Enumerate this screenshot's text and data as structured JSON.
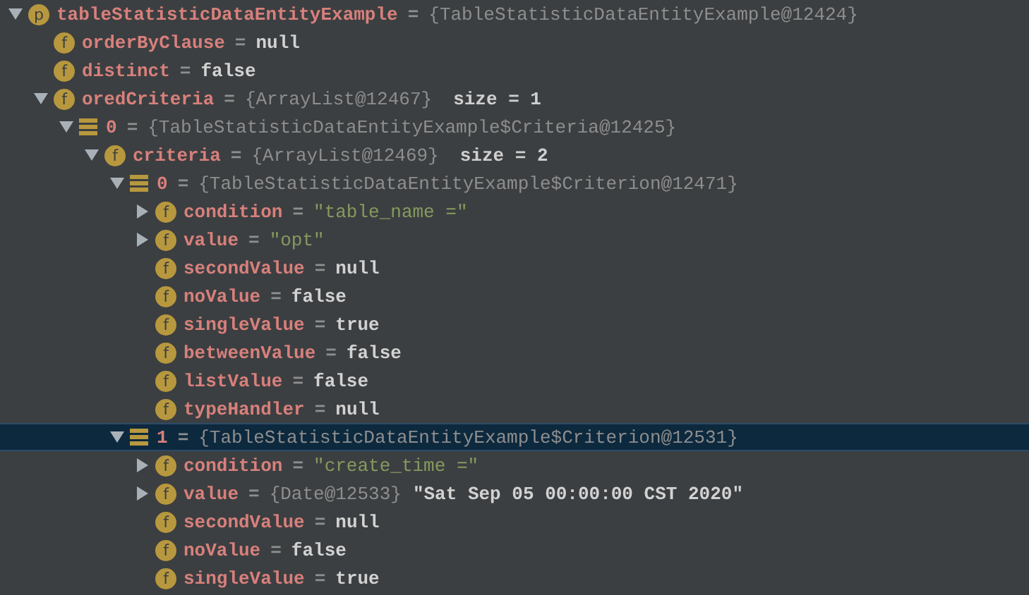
{
  "tree": [
    {
      "name": "tableStatisticDataEntityExample",
      "kind": "parameter",
      "badge": "p",
      "expanded": true,
      "selected": false,
      "sep": "=",
      "ref": "{TableStatisticDataEntityExample@12424}",
      "children": [
        {
          "name": "orderByClause",
          "kind": "field",
          "badge": "f",
          "selected": false,
          "sep": "=",
          "value": "null"
        },
        {
          "name": "distinct",
          "kind": "field",
          "badge": "f",
          "selected": false,
          "sep": "=",
          "value": "false"
        },
        {
          "name": "oredCriteria",
          "kind": "field",
          "badge": "f",
          "expanded": true,
          "selected": false,
          "sep": "=",
          "ref": "{ArrayList@12467}",
          "extra": "size = 1",
          "children": [
            {
              "name": "0",
              "kind": "element",
              "expanded": true,
              "selected": false,
              "sep": "=",
              "ref": "{TableStatisticDataEntityExample$Criteria@12425}",
              "children": [
                {
                  "name": "criteria",
                  "kind": "field",
                  "badge": "f",
                  "expanded": true,
                  "selected": false,
                  "sep": "=",
                  "ref": "{ArrayList@12469}",
                  "extra": "size = 2",
                  "children": [
                    {
                      "name": "0",
                      "kind": "element",
                      "expanded": true,
                      "selected": false,
                      "sep": "=",
                      "ref": "{TableStatisticDataEntityExample$Criterion@12471}",
                      "children": [
                        {
                          "name": "condition",
                          "kind": "field",
                          "badge": "f",
                          "expanded": false,
                          "selected": false,
                          "sep": "=",
                          "string": "\"table_name =\""
                        },
                        {
                          "name": "value",
                          "kind": "field",
                          "badge": "f",
                          "expanded": false,
                          "selected": false,
                          "sep": "=",
                          "string": "\"opt\""
                        },
                        {
                          "name": "secondValue",
                          "kind": "field",
                          "badge": "f",
                          "selected": false,
                          "sep": "=",
                          "value": "null"
                        },
                        {
                          "name": "noValue",
                          "kind": "field",
                          "badge": "f",
                          "selected": false,
                          "sep": "=",
                          "value": "false"
                        },
                        {
                          "name": "singleValue",
                          "kind": "field",
                          "badge": "f",
                          "selected": false,
                          "sep": "=",
                          "value": "true"
                        },
                        {
                          "name": "betweenValue",
                          "kind": "field",
                          "badge": "f",
                          "selected": false,
                          "sep": "=",
                          "value": "false"
                        },
                        {
                          "name": "listValue",
                          "kind": "field",
                          "badge": "f",
                          "selected": false,
                          "sep": "=",
                          "value": "false"
                        },
                        {
                          "name": "typeHandler",
                          "kind": "field",
                          "badge": "f",
                          "selected": false,
                          "sep": "=",
                          "value": "null"
                        }
                      ]
                    },
                    {
                      "name": "1",
                      "kind": "element",
                      "expanded": true,
                      "selected": true,
                      "sep": "=",
                      "ref": "{TableStatisticDataEntityExample$Criterion@12531}",
                      "children": [
                        {
                          "name": "condition",
                          "kind": "field",
                          "badge": "f",
                          "expanded": false,
                          "selected": false,
                          "sep": "=",
                          "string": "\"create_time =\""
                        },
                        {
                          "name": "value",
                          "kind": "field",
                          "badge": "f",
                          "expanded": false,
                          "selected": false,
                          "sep": "=",
                          "ref": "{Date@12533}",
                          "value": "\"Sat Sep 05 00:00:00 CST 2020\""
                        },
                        {
                          "name": "secondValue",
                          "kind": "field",
                          "badge": "f",
                          "selected": false,
                          "sep": "=",
                          "value": "null"
                        },
                        {
                          "name": "noValue",
                          "kind": "field",
                          "badge": "f",
                          "selected": false,
                          "sep": "=",
                          "value": "false"
                        },
                        {
                          "name": "singleValue",
                          "kind": "field",
                          "badge": "f",
                          "selected": false,
                          "sep": "=",
                          "value": "true"
                        }
                      ]
                    }
                  ]
                }
              ]
            }
          ]
        }
      ]
    }
  ]
}
